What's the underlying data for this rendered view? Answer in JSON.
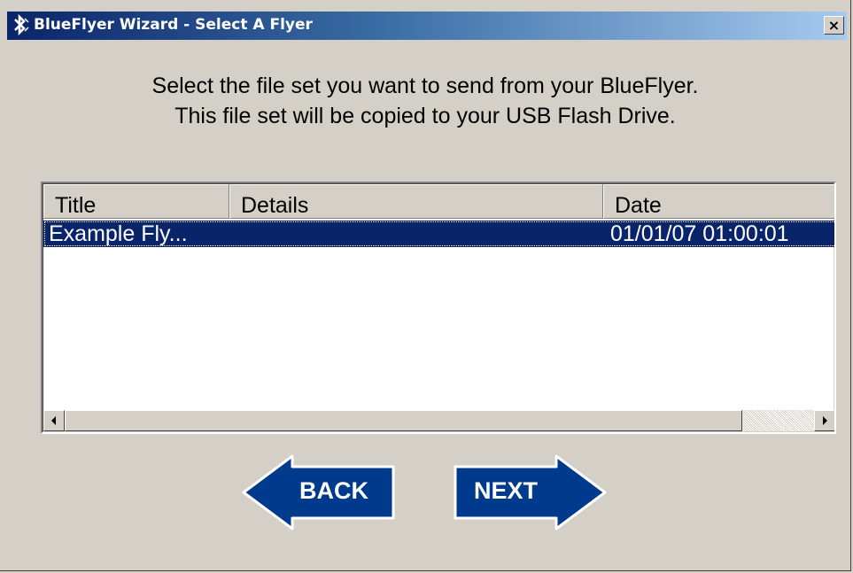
{
  "window": {
    "title": "BlueFlyer Wizard - Select A Flyer",
    "close_label": "×",
    "icon": "bluetooth-icon"
  },
  "instructions": {
    "line1": "Select the file set you want to send from your BlueFlyer.",
    "line2": "This file set will be copied to your USB Flash Drive."
  },
  "list": {
    "columns": [
      "Title",
      "Details",
      "Date"
    ],
    "rows": [
      {
        "title": "Example Fly...",
        "details": "",
        "date": "01/01/07 01:00:01",
        "selected": true
      }
    ]
  },
  "buttons": {
    "back_label": "BACK",
    "next_label": "NEXT"
  },
  "colors": {
    "accent": "#0a246a",
    "button_blue": "#003a8c",
    "window_bg": "#d4d0c8"
  }
}
